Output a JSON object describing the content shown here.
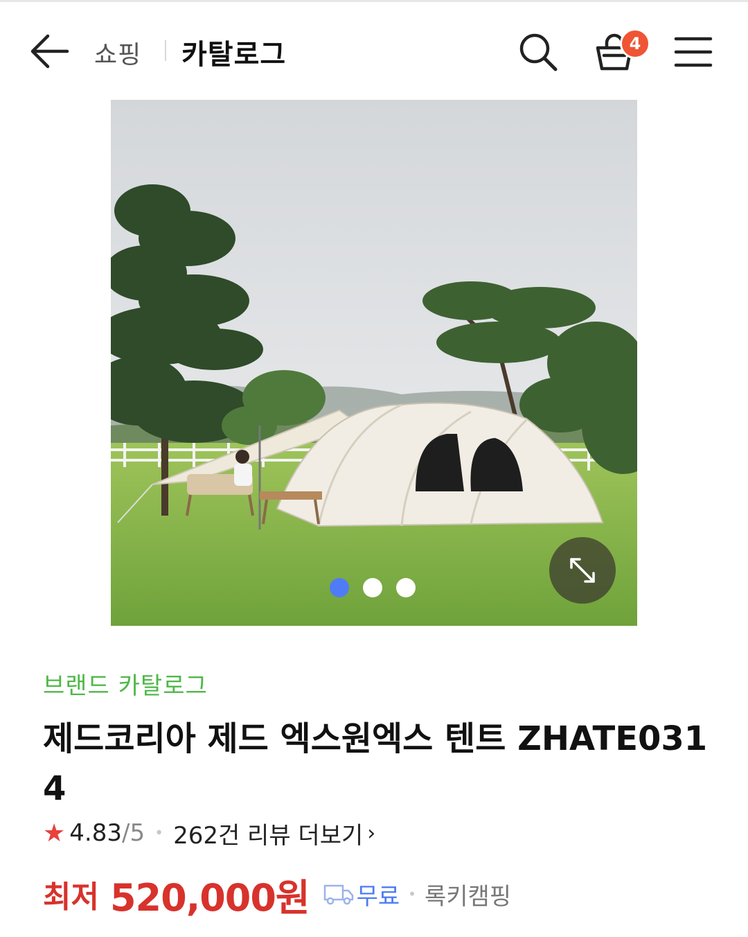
{
  "header": {
    "breadcrumb_parent": "쇼핑",
    "breadcrumb_current": "카탈로그",
    "cart_count": "4",
    "icons": [
      "back-arrow-icon",
      "search-icon",
      "shopping-bag-icon",
      "hamburger-menu-icon"
    ]
  },
  "gallery": {
    "total_images": 3,
    "active_index": 0,
    "expand_icon": "expand-diagonal-icon"
  },
  "product": {
    "brand_link": "브랜드 카탈로그",
    "title": "제드코리아 제드 엑스원엑스 텐트 ZHATE0314",
    "rating": "4.83",
    "rating_max": "/5",
    "review_link": "262건 리뷰 더보기",
    "price_label": "최저",
    "price": "520,000원",
    "shipping": "무료",
    "seller": "록키캠핑"
  },
  "colors": {
    "price_red": "#d8322c",
    "brand_green": "#4fb848",
    "accent_blue": "#4f7cf5",
    "badge_orange": "#ef5434",
    "star_red": "#e8413b"
  }
}
